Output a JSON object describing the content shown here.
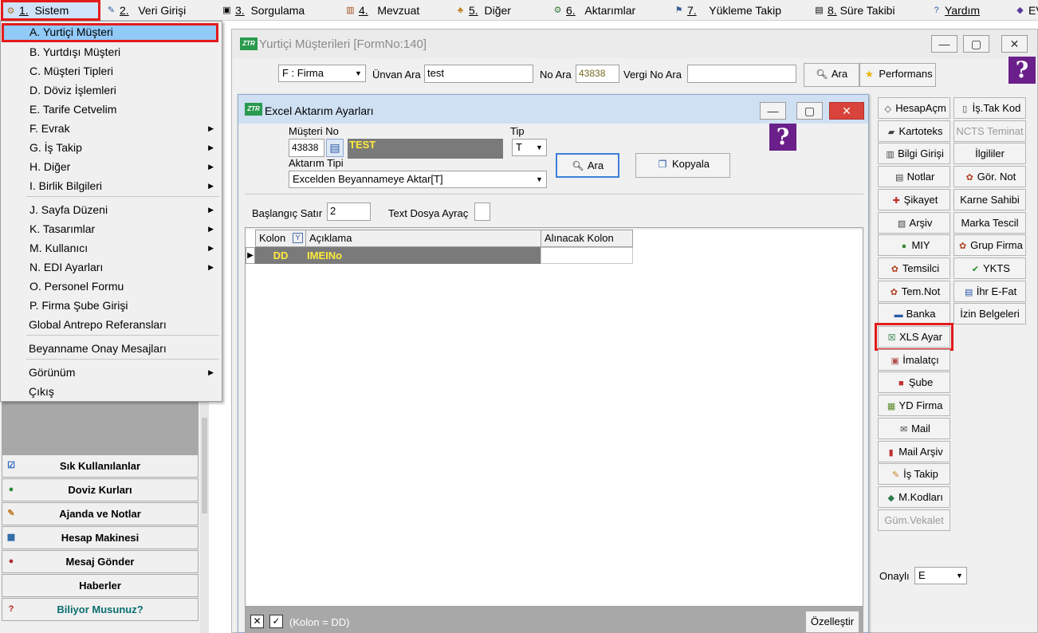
{
  "menubar": {
    "items": [
      {
        "num": "1.",
        "label": "Sistem",
        "icon": "gear-icon"
      },
      {
        "num": "2.",
        "label": "Veri Girişi",
        "icon": "edit-icon"
      },
      {
        "num": "3.",
        "label": "Sorgulama",
        "icon": "query-icon"
      },
      {
        "num": "4.",
        "label": "Mevzuat",
        "icon": "books-icon"
      },
      {
        "num": "5.",
        "label": "Diğer",
        "icon": "misc-icon"
      },
      {
        "num": "6.",
        "label": "Aktarımlar",
        "icon": "transfer-icon"
      },
      {
        "num": "7.",
        "label": "Yükleme Takip",
        "icon": "tracking-icon"
      },
      {
        "num": "8.",
        "label": "Süre Takibi",
        "icon": "timer-icon"
      },
      {
        "num": "",
        "label": "Yardım",
        "icon": "help-icon"
      },
      {
        "num": "",
        "label": "EV",
        "icon": "ev-icon"
      }
    ]
  },
  "dropdown": {
    "items": [
      {
        "label": "A.  Yurtiçi Müşteri",
        "arrow": false
      },
      {
        "label": "B.  Yurtdışı Müşteri",
        "arrow": false
      },
      {
        "label": "C.  Müşteri Tipleri",
        "arrow": false
      },
      {
        "label": "D.  Döviz İşlemleri",
        "arrow": false
      },
      {
        "label": "E.  Tarife Cetvelim",
        "arrow": false
      },
      {
        "label": "F.  Evrak",
        "arrow": true
      },
      {
        "label": "G.  İş Takip",
        "arrow": true
      },
      {
        "label": "H.  Diğer",
        "arrow": true
      },
      {
        "label": "I.  Birlik Bilgileri",
        "arrow": true
      },
      {
        "label": "J.  Sayfa Düzeni",
        "arrow": true
      },
      {
        "label": "K.  Tasarımlar",
        "arrow": true
      },
      {
        "label": "M.  Kullanıcı",
        "arrow": true
      },
      {
        "label": "N.  EDI Ayarları",
        "arrow": true
      },
      {
        "label": "O.  Personel Formu",
        "arrow": false
      },
      {
        "label": "P.  Firma Şube Girişi",
        "arrow": false
      },
      {
        "label": "Global Antrepo Referansları",
        "arrow": false
      },
      {
        "label": "Beyanname Onay Mesajları",
        "arrow": false
      },
      {
        "label": "Görünüm",
        "arrow": true
      },
      {
        "label": "Çıkış",
        "arrow": false
      }
    ]
  },
  "leftpane": {
    "buttons": [
      {
        "label": "Sık Kullanılanlar",
        "icon": "favorites-icon"
      },
      {
        "label": "Doviz Kurları",
        "icon": "currency-icon"
      },
      {
        "label": "Ajanda ve Notlar",
        "icon": "agenda-icon"
      },
      {
        "label": "Hesap Makinesi",
        "icon": "calculator-icon"
      },
      {
        "label": "Mesaj Gönder",
        "icon": "message-icon"
      },
      {
        "label": "Haberler",
        "icon": ""
      },
      {
        "label": "Biliyor Musunuz?",
        "icon": "question-icon"
      }
    ]
  },
  "mainwin": {
    "title": "Yurtiçi Müşterileri [FormNo:140]",
    "type_combo": "F : Firma",
    "unvan_label": "Ünvan Ara",
    "unvan_value": "test",
    "no_label": "No Ara",
    "no_value": "43838",
    "vergi_label": "Vergi No Ara",
    "vergi_value": "",
    "search_btn": "Ara",
    "perf_btn": "Performans",
    "help": "?",
    "onayli_label": "Onaylı",
    "onayli_value": "E",
    "right_col1": [
      {
        "label": "HesapAçm",
        "icon": "account-icon",
        "dis": false
      },
      {
        "label": "Kartoteks",
        "icon": "card-icon",
        "dis": false
      },
      {
        "label": "Bilgi Girişi",
        "icon": "info-icon",
        "dis": false
      },
      {
        "label": "Notlar",
        "icon": "notes-icon",
        "dis": false
      },
      {
        "label": "Şikayet",
        "icon": "complaint-icon",
        "dis": false
      },
      {
        "label": "Arşiv",
        "icon": "archive-icon",
        "dis": false
      },
      {
        "label": "MIY",
        "icon": "miy-icon",
        "dis": false
      },
      {
        "label": "Temsilci",
        "icon": "rep-icon",
        "dis": false
      },
      {
        "label": "Tem.Not",
        "icon": "rep-note-icon",
        "dis": false
      },
      {
        "label": "Banka",
        "icon": "bank-icon",
        "dis": false
      },
      {
        "label": "XLS Ayar",
        "icon": "excel-icon",
        "dis": false
      },
      {
        "label": "İmalatçı",
        "icon": "manufacturer-icon",
        "dis": false
      },
      {
        "label": "Şube",
        "icon": "branch-icon",
        "dis": false
      },
      {
        "label": "YD Firma",
        "icon": "foreign-firm-icon",
        "dis": false
      },
      {
        "label": "Mail",
        "icon": "mail-icon",
        "dis": false
      },
      {
        "label": "Mail Arşiv",
        "icon": "mail-archive-icon",
        "dis": false
      },
      {
        "label": "İş Takip",
        "icon": "job-tracking-icon",
        "dis": false
      },
      {
        "label": "M.Kodları",
        "icon": "codes-icon",
        "dis": false
      },
      {
        "label": "Güm.Vekalet",
        "icon": "",
        "dis": true
      }
    ],
    "right_col2": [
      {
        "label": "İş.Tak Kod",
        "icon": "job-code-icon",
        "dis": false
      },
      {
        "label": "NCTS Teminat",
        "icon": "",
        "dis": true
      },
      {
        "label": "İlgililer",
        "icon": "",
        "dis": false
      },
      {
        "label": "Gör. Not",
        "icon": "view-note-icon",
        "dis": false
      },
      {
        "label": "Karne Sahibi",
        "icon": "",
        "dis": false
      },
      {
        "label": "Marka Tescil",
        "icon": "",
        "dis": false
      },
      {
        "label": "Grup Firma",
        "icon": "group-firm-icon",
        "dis": false
      },
      {
        "label": "YKTS",
        "icon": "check-icon",
        "dis": false
      },
      {
        "label": "İhr E-Fat",
        "icon": "invoice-icon",
        "dis": false
      },
      {
        "label": "İzin Belgeleri",
        "icon": "",
        "dis": false
      }
    ]
  },
  "dialog": {
    "title": "Excel Aktarım Ayarları",
    "musteri_label": "Müşteri No",
    "musteri_value": "43838",
    "musteri_name": "TEST",
    "tip_label": "Tip",
    "tip_value": "T",
    "aktarim_label": "Aktarım Tipi",
    "aktarim_value": "Excelden Beyannameye Aktar[T]",
    "ara_btn": "Ara",
    "kopyala_btn": "Kopyala",
    "help": "?",
    "baslangic_label": "Başlangıç Satır",
    "baslangic_value": "2",
    "ayrac_label": "Text Dosya Ayraç",
    "ayrac_value": "",
    "grid": {
      "headers": [
        "Kolon",
        "Açıklama",
        "Alınacak Kolon"
      ],
      "rows": [
        {
          "kolon": "DD",
          "aciklama": "IMEINo",
          "alinacak": ""
        }
      ]
    },
    "filter_text": "(Kolon = DD)",
    "ozellestir_btn": "Özelleştir"
  }
}
